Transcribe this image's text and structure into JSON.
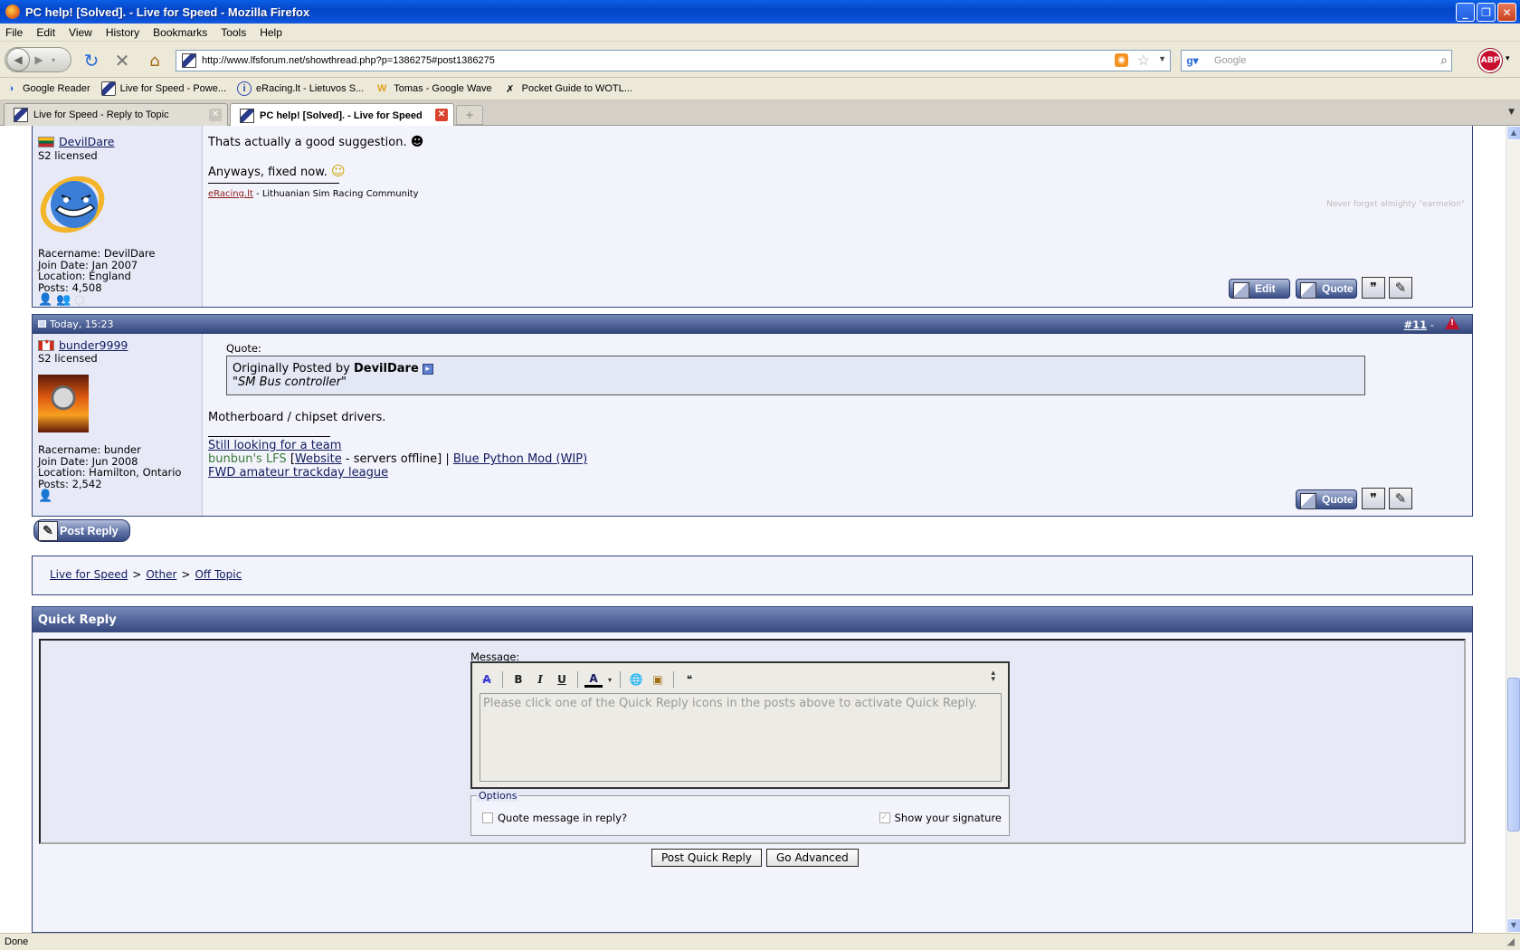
{
  "window": {
    "title": "PC help! [Solved]. - Live for Speed - Mozilla Firefox",
    "minimize": "_",
    "maximize": "❐",
    "close": "✕"
  },
  "menu": [
    "File",
    "Edit",
    "View",
    "History",
    "Bookmarks",
    "Tools",
    "Help"
  ],
  "nav": {
    "url": "http://www.lfsforum.net/showthread.php?p=1386275#post1386275",
    "search_placeholder": "Google",
    "abp": "ABP"
  },
  "bookmarks": [
    {
      "label": "Google Reader",
      "icon": "google-reader-icon"
    },
    {
      "label": "Live for Speed - Powe...",
      "icon": "lfs-icon"
    },
    {
      "label": "eRacing.lt - Lietuvos S...",
      "icon": "info-icon"
    },
    {
      "label": "Tomas - Google Wave",
      "icon": "google-wave-icon"
    },
    {
      "label": "Pocket Guide to WOTL...",
      "icon": "figure-icon"
    }
  ],
  "tabs": [
    {
      "label": "Live for Speed - Reply to Topic",
      "active": false
    },
    {
      "label": "PC help! [Solved]. - Live for Speed",
      "active": true
    }
  ],
  "post1": {
    "username": "DevilDare",
    "user_title": "S2 licensed",
    "info": [
      "Racername: DevilDare",
      "Join Date: Jan 2007",
      "Location: England",
      "Posts: 4,508"
    ],
    "line1": "Thats actually a good suggestion.",
    "line2": "Anyways, fixed now.",
    "sig_link": "eRacing.lt",
    "sig_rest": " - Lithuanian Sim Racing Community",
    "sig_right": "Never forget almighty \"earmelon\"",
    "btn_edit": "Edit",
    "btn_quote": "Quote"
  },
  "post2": {
    "date": "Today, 15:23",
    "number_prefix": "#",
    "number": "11",
    "number_suffix": " -",
    "username": "bunder9999",
    "user_title": "S2 licensed",
    "info": [
      "Racername: bunder",
      "Join Date: Jun 2008",
      "Location: Hamilton, Ontario",
      "Posts: 2,542"
    ],
    "quote_label": "Quote:",
    "quote_by_prefix": "Originally Posted by ",
    "quote_author": "DevilDare",
    "quote_text": "\"SM Bus controller\"",
    "body": "Motherboard / chipset drivers.",
    "sig1": "Still looking for a team",
    "sig2_green": "bunbun's LFS",
    "sig2_a": " [",
    "sig2_link1": "Website",
    "sig2_b": " - servers offline] | ",
    "sig2_link2": "Blue Python Mod (WIP)",
    "sig3": "FWD amateur trackday league",
    "btn_quote": "Quote"
  },
  "post_reply": "Post Reply",
  "breadcrumb": [
    "Live for Speed",
    "Other",
    "Off Topic"
  ],
  "breadcrumb_sep": ">",
  "quick_reply": {
    "title": "Quick Reply",
    "message_label": "Message:",
    "placeholder": "Please click one of the Quick Reply icons in the posts above to activate Quick Reply.",
    "options_label": "Options",
    "quote_msg": "Quote message in reply?",
    "show_sig": "Show your signature",
    "post_btn": "Post Quick Reply",
    "advanced_btn": "Go Advanced"
  },
  "status": "Done"
}
